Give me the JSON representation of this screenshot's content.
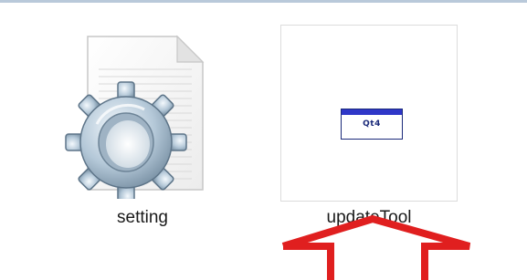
{
  "files": [
    {
      "name": "setting",
      "type": "config-settings-file",
      "selected": false
    },
    {
      "name": "updateTool",
      "type": "application",
      "selected": true,
      "icon_text": "Qt4"
    }
  ],
  "annotation": {
    "shape": "up-arrow",
    "color": "#e01f1f"
  },
  "colors": {
    "window_border": "#b9c9da",
    "app_titlebar": "#2f37c8",
    "annotation": "#e01f1f"
  }
}
